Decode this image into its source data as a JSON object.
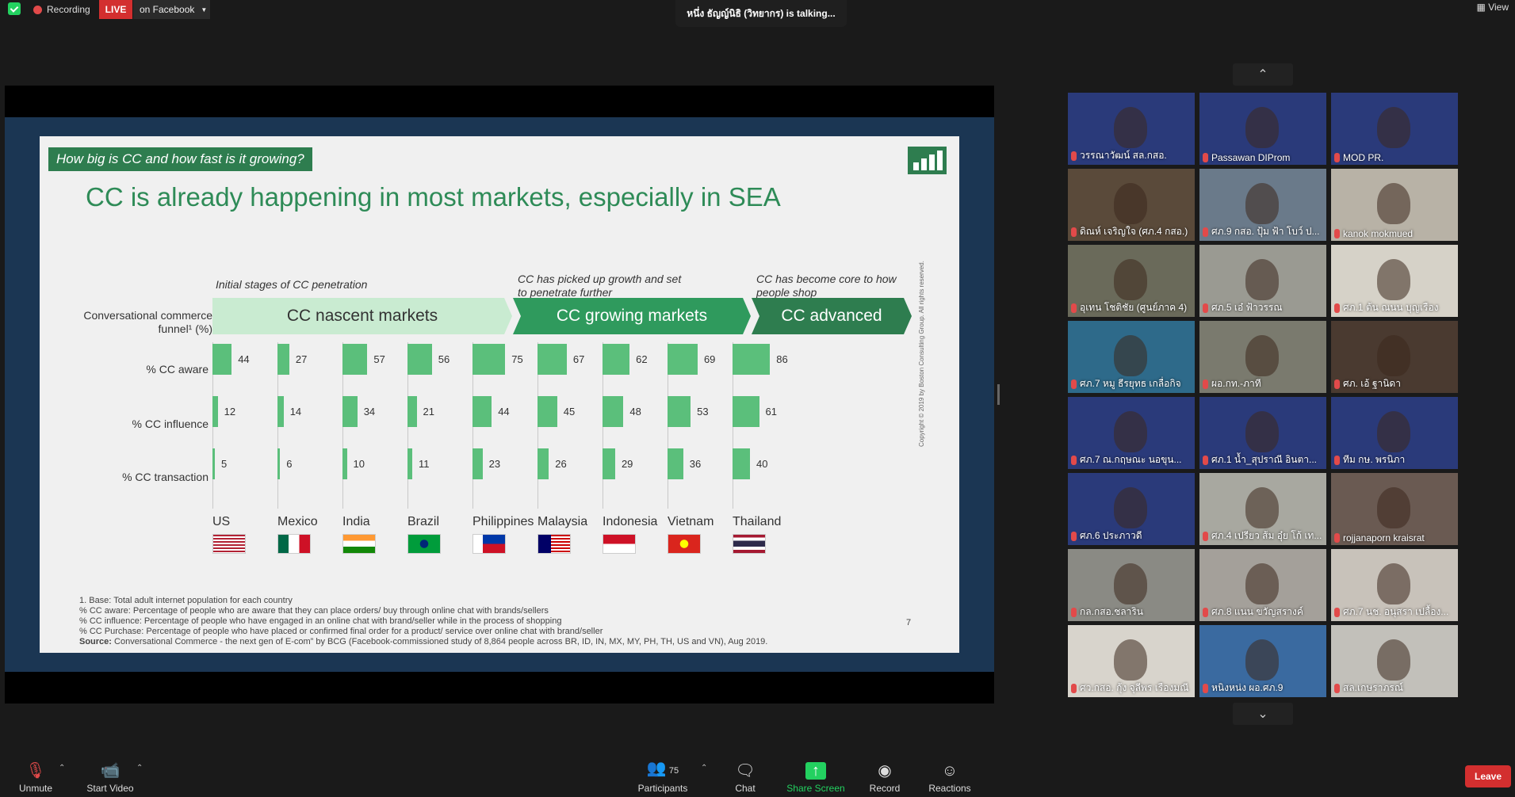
{
  "topbar": {
    "recording": "Recording",
    "live": "LIVE",
    "facebook": "on Facebook",
    "talking": "หนึ่ง ธัญญ์นิธิ (วิทยากร) is talking...",
    "view": "View"
  },
  "slide": {
    "question": "How big is CC and how fast is it growing?",
    "title": "CC is already happening in most markets, especially in SEA",
    "phase1": "Initial stages of CC penetration",
    "phase2": "CC has picked up growth and set to penetrate further",
    "phase3": "CC has become core to how people shop",
    "funnel_label": "Conversational commerce funnel¹ (%)",
    "band1": "CC nascent markets",
    "band2": "CC growing markets",
    "band3": "CC advanced",
    "page_number": "7",
    "copyright": "Copyright © 2019 by Boston Consulting Group. All rights reserved.",
    "footnotes": [
      "1.   Base: Total adult internet population for each country",
      "% CC aware: Percentage of people who are aware that they can place orders/ buy through online chat with brands/sellers",
      "% CC influence: Percentage of people who have engaged in an online chat with brand/seller while in the process of shopping",
      "% CC Purchase: Percentage of people who have placed or confirmed final order for a product/ service over online chat with brand/seller"
    ],
    "source_label": "Source:",
    "source_text": " Conversational Commerce - the next gen of E-com” by BCG (Facebook-commissioned study of 8,864 people across BR, ID, IN, MX, MY, PH, TH, US and VN), Aug 2019."
  },
  "chart_data": {
    "type": "bar",
    "categories": [
      "US",
      "Mexico",
      "India",
      "Brazil",
      "Philippines",
      "Malaysia",
      "Indonesia",
      "Vietnam",
      "Thailand"
    ],
    "series": [
      {
        "name": "% CC aware",
        "values": [
          44,
          27,
          57,
          56,
          75,
          67,
          62,
          69,
          86
        ]
      },
      {
        "name": "% CC influence",
        "values": [
          12,
          14,
          34,
          21,
          44,
          45,
          48,
          53,
          61
        ]
      },
      {
        "name": "% CC transaction",
        "values": [
          5,
          6,
          10,
          11,
          23,
          26,
          29,
          36,
          40
        ]
      }
    ],
    "ylim": [
      0,
      100
    ],
    "bar_color": "#5bbf7b"
  },
  "participants": [
    {
      "name": "วรรณาวัฒน์ สล.กสอ.",
      "bg": "#2a3a7a"
    },
    {
      "name": "Passawan DIProm",
      "bg": "#2a3a7a"
    },
    {
      "name": "MOD PR.",
      "bg": "#2a3a7a"
    },
    {
      "name": "ดิณห์ เจริญใจ (ศภ.4 กสอ.)",
      "bg": "#5a4a3a"
    },
    {
      "name": "ศภ.9 กสอ. ปุ้ม ฟ้า โบว์ ป...",
      "bg": "#6a7a8a"
    },
    {
      "name": "kanok mokmued",
      "bg": "#b8b2a6"
    },
    {
      "name": "อุเทน โชติชัย (ศูนย์ภาค 4)",
      "bg": "#6a6a5a"
    },
    {
      "name": "ศภ.5 เอ๋ ฟ้าวรรณ",
      "bg": "#9a9a92"
    },
    {
      "name": "ศภ.1 ต้น ณนน บุญเรือง",
      "bg": "#d6d2c8"
    },
    {
      "name": "ศภ.7 หมู ธีรยุทธ เกลื่อกิจ",
      "bg": "#2e6a8a"
    },
    {
      "name": "ผอ.กท.-ภาที",
      "bg": "#7a7a6e"
    },
    {
      "name": "ศภ. เอ้ ฐานิดา",
      "bg": "#4a3a30"
    },
    {
      "name": "ศภ.7 ณ.กฤษณะ นอขุน...",
      "bg": "#2a3a7a"
    },
    {
      "name": "ศภ.1 น้ำ_สุปราณี อินตา...",
      "bg": "#2a3a7a"
    },
    {
      "name": "ทีม กษ. พรนิภา",
      "bg": "#2a3a7a"
    },
    {
      "name": "ศภ.6 ประภาวดี",
      "bg": "#2a3a7a"
    },
    {
      "name": "ศภ.4 เปรียว ส้ม อุ๋ย โก้ เท...",
      "bg": "#a8a8a0"
    },
    {
      "name": "rojjanaporn kraisrat",
      "bg": "#6a5a52"
    },
    {
      "name": "กล.กสอ.ชลาริน",
      "bg": "#8a8a84"
    },
    {
      "name": "ศภ.8 แนน ขวัญสรางค์",
      "bg": "#a4a09a"
    },
    {
      "name": "ศภ.7 นช. อนุสรา เปลื้อง...",
      "bg": "#c8c2ba"
    },
    {
      "name": "ศว.กสอ. กุ้ง จุลีพร เรืองมณี",
      "bg": "#d8d4cc"
    },
    {
      "name": "หนิงหน่ง ผอ.ศภ.9",
      "bg": "#3a6aa0"
    },
    {
      "name": "สล.เกษราภรณ์",
      "bg": "#c2c0ba"
    }
  ],
  "toolbar": {
    "unmute": "Unmute",
    "start_video": "Start Video",
    "participants": "Participants",
    "participants_count": "75",
    "chat": "Chat",
    "share_screen": "Share Screen",
    "record": "Record",
    "reactions": "Reactions",
    "leave": "Leave"
  }
}
